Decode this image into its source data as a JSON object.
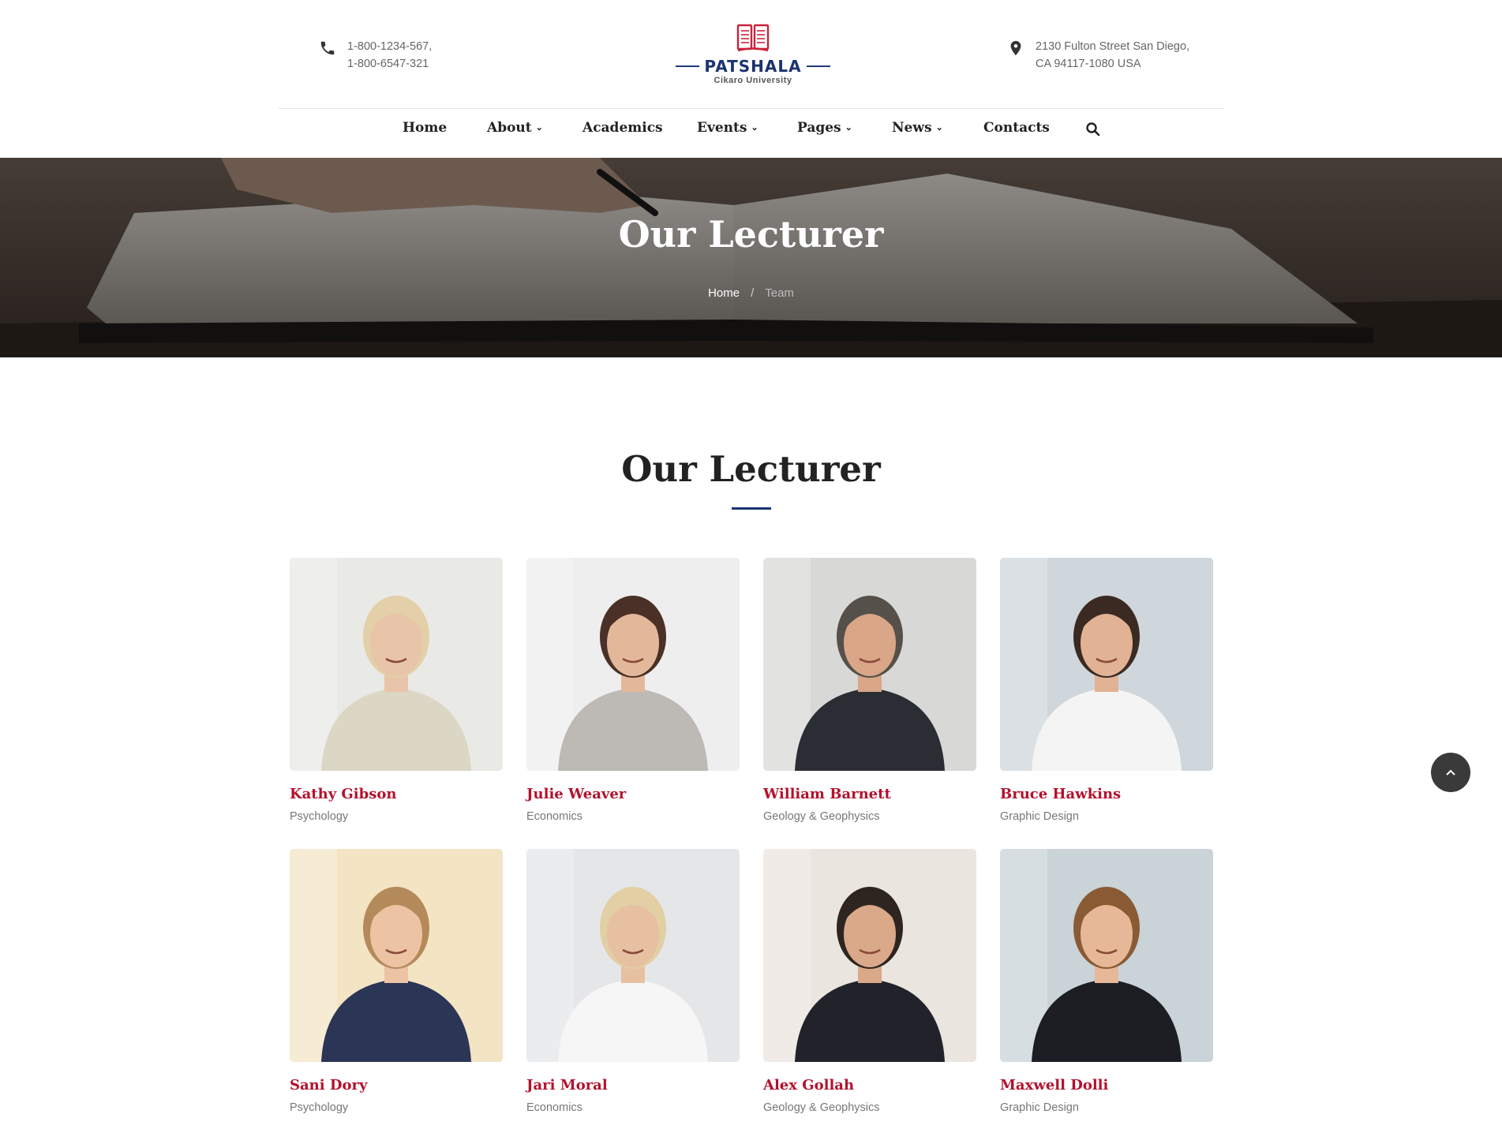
{
  "header": {
    "phone_lines": [
      "1-800-1234-567,",
      "1-800-6547-321"
    ],
    "address_lines": [
      "2130 Fulton Street San Diego,",
      "CA 94117-1080 USA"
    ],
    "logo": {
      "brand": "PATSHALA",
      "subtitle": "Cikaro University"
    }
  },
  "nav": {
    "items": [
      {
        "label": "Home",
        "has_dropdown": false
      },
      {
        "label": "About",
        "has_dropdown": true
      },
      {
        "label": "Academics",
        "has_dropdown": false
      },
      {
        "label": "Events",
        "has_dropdown": true
      },
      {
        "label": "Pages",
        "has_dropdown": true
      },
      {
        "label": "News",
        "has_dropdown": true
      },
      {
        "label": "Contacts",
        "has_dropdown": false
      }
    ],
    "caret": "⌄"
  },
  "hero": {
    "title": "Our Lecturer",
    "breadcrumb": {
      "home": "Home",
      "separator": "/",
      "current": "Team"
    }
  },
  "section": {
    "title": "Our Lecturer"
  },
  "lecturers": [
    {
      "name": "Kathy Gibson",
      "department": "Psychology",
      "bg": "#e9e9e6",
      "skin": "#e8c4a8",
      "hair": "#e3cfa8",
      "outfit": "#dcd6c4"
    },
    {
      "name": "Julie Weaver",
      "department": "Economics",
      "bg": "#eeeeee",
      "skin": "#e3b89a",
      "hair": "#4a3026",
      "outfit": "#bdbab6"
    },
    {
      "name": "William Barnett",
      "department": "Geology & Geophysics",
      "bg": "#d8d8d6",
      "skin": "#d9a688",
      "hair": "#555049",
      "outfit": "#2a2d33"
    },
    {
      "name": "Bruce Hawkins",
      "department": "Graphic Design",
      "bg": "#cfd6dc",
      "skin": "#e2b295",
      "hair": "#3a2a22",
      "outfit": "#f4f4f4"
    },
    {
      "name": "Sani Dory",
      "department": "Psychology",
      "bg": "#f3e4c4",
      "skin": "#ecc3a3",
      "hair": "#b58a5a",
      "outfit": "#2b3556"
    },
    {
      "name": "Jari Moral",
      "department": "Economics",
      "bg": "#e4e6e8",
      "skin": "#e7c0a2",
      "hair": "#e2cfa4",
      "outfit": "#f6f6f6"
    },
    {
      "name": "Alex Gollah",
      "department": "Geology & Geophysics",
      "bg": "#ebe5df",
      "skin": "#d9a98a",
      "hair": "#2e2520",
      "outfit": "#22232a"
    },
    {
      "name": "Maxwell Dolli",
      "department": "Graphic Design",
      "bg": "#c9d3d8",
      "skin": "#e6b898",
      "hair": "#8a5a34",
      "outfit": "#1c1e24"
    }
  ],
  "colors": {
    "accent_red": "#b3112c",
    "brand_navy": "#1b3371"
  }
}
